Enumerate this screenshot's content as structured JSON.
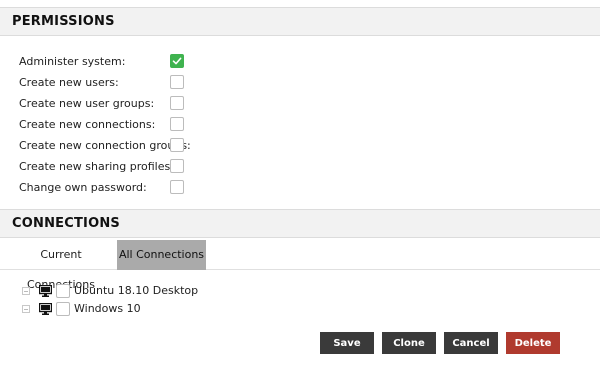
{
  "permissions": {
    "title": "PERMISSIONS",
    "items": [
      {
        "label": "Administer system:",
        "checked": true
      },
      {
        "label": "Create new users:",
        "checked": false
      },
      {
        "label": "Create new user groups:",
        "checked": false
      },
      {
        "label": "Create new connections:",
        "checked": false
      },
      {
        "label": "Create new connection groups:",
        "checked": false
      },
      {
        "label": "Create new sharing profiles:",
        "checked": false
      },
      {
        "label": "Change own password:",
        "checked": false
      }
    ]
  },
  "connections": {
    "title": "CONNECTIONS",
    "tabs": [
      {
        "label": "Current Connections",
        "active": false
      },
      {
        "label": "All Connections",
        "active": true
      }
    ],
    "items": [
      {
        "label": "Ubuntu 18.10 Desktop",
        "icon": "monitor-icon",
        "checked": false
      },
      {
        "label": "Windows 10",
        "icon": "monitor-icon",
        "checked": false
      }
    ]
  },
  "actions": {
    "save": "Save",
    "clone": "Clone",
    "cancel": "Cancel",
    "delete": "Delete"
  },
  "colors": {
    "check_green": "#3fb34f",
    "button_dark": "#3a3a3a",
    "button_delete": "#b03a2e",
    "active_tab": "#aaaaaa"
  }
}
